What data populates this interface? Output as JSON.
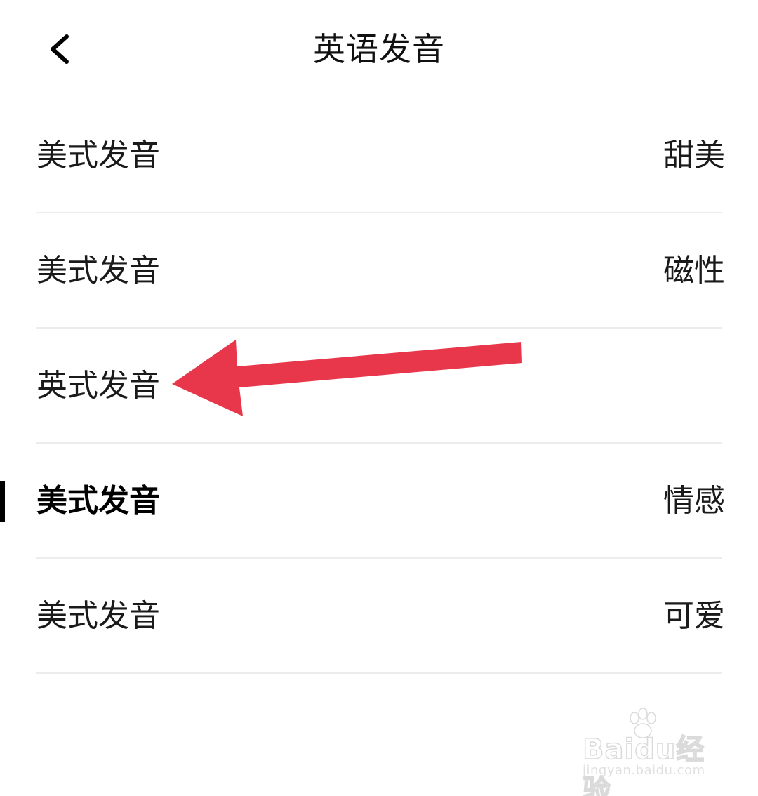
{
  "header": {
    "title": "英语发音",
    "back_icon": "chevron-left-icon"
  },
  "voices": [
    {
      "label": "美式发音",
      "value": "甜美",
      "selected": false
    },
    {
      "label": "美式发音",
      "value": "磁性",
      "selected": false
    },
    {
      "label": "英式发音",
      "value": "",
      "selected": false
    },
    {
      "label": "美式发音",
      "value": "情感",
      "selected": true
    },
    {
      "label": "美式发音",
      "value": "可爱",
      "selected": false
    }
  ],
  "annotation": {
    "arrow_color": "#e8374a",
    "points_to": "英式发音"
  },
  "watermark": {
    "brand": "Baidu经验",
    "url": "jingyan.baidu.com"
  },
  "colors": {
    "background": "#ffffff",
    "text": "#1a1a1a",
    "divider": "#ececec",
    "selected_indicator": "#000000"
  }
}
